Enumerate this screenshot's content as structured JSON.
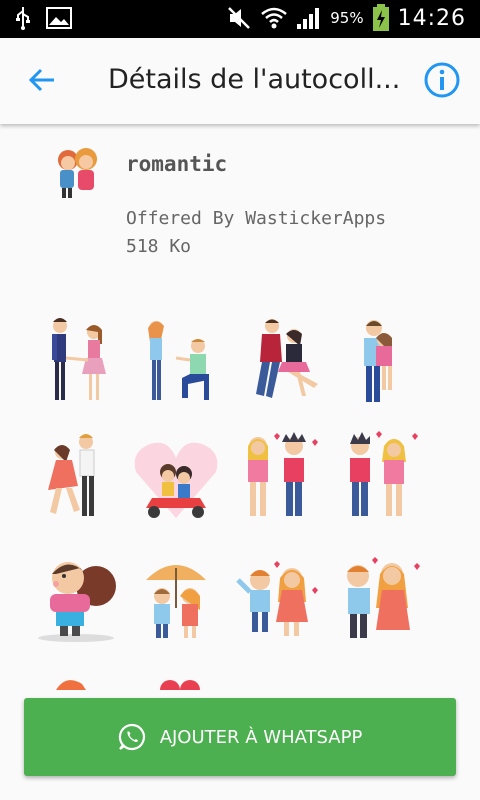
{
  "status_bar": {
    "battery": "95%",
    "time": "14:26"
  },
  "toolbar": {
    "title": "Détails de l'autocoll..."
  },
  "pack": {
    "name": "romantic",
    "publisher": "Offered By WastickerApps",
    "size": "518 Ko"
  },
  "actions": {
    "add_label": "AJOUTER À WHATSAPP"
  },
  "colors": {
    "accent": "#2196f3",
    "button": "#4caf50"
  },
  "stickers": [
    {
      "icon": "couple-holding-hands-sticker"
    },
    {
      "icon": "proposal-sticker"
    },
    {
      "icon": "couple-jumping-sticker"
    },
    {
      "icon": "couple-hug-sticker"
    },
    {
      "icon": "couple-dancing-sticker"
    },
    {
      "icon": "couple-scooter-heart-sticker"
    },
    {
      "icon": "couple-hearts-sticker"
    },
    {
      "icon": "couple-hearts-2-sticker"
    },
    {
      "icon": "couple-kiss-sticker"
    },
    {
      "icon": "couple-umbrella-sticker"
    },
    {
      "icon": "couple-cheering-sticker"
    },
    {
      "icon": "couple-walking-sticker"
    }
  ]
}
